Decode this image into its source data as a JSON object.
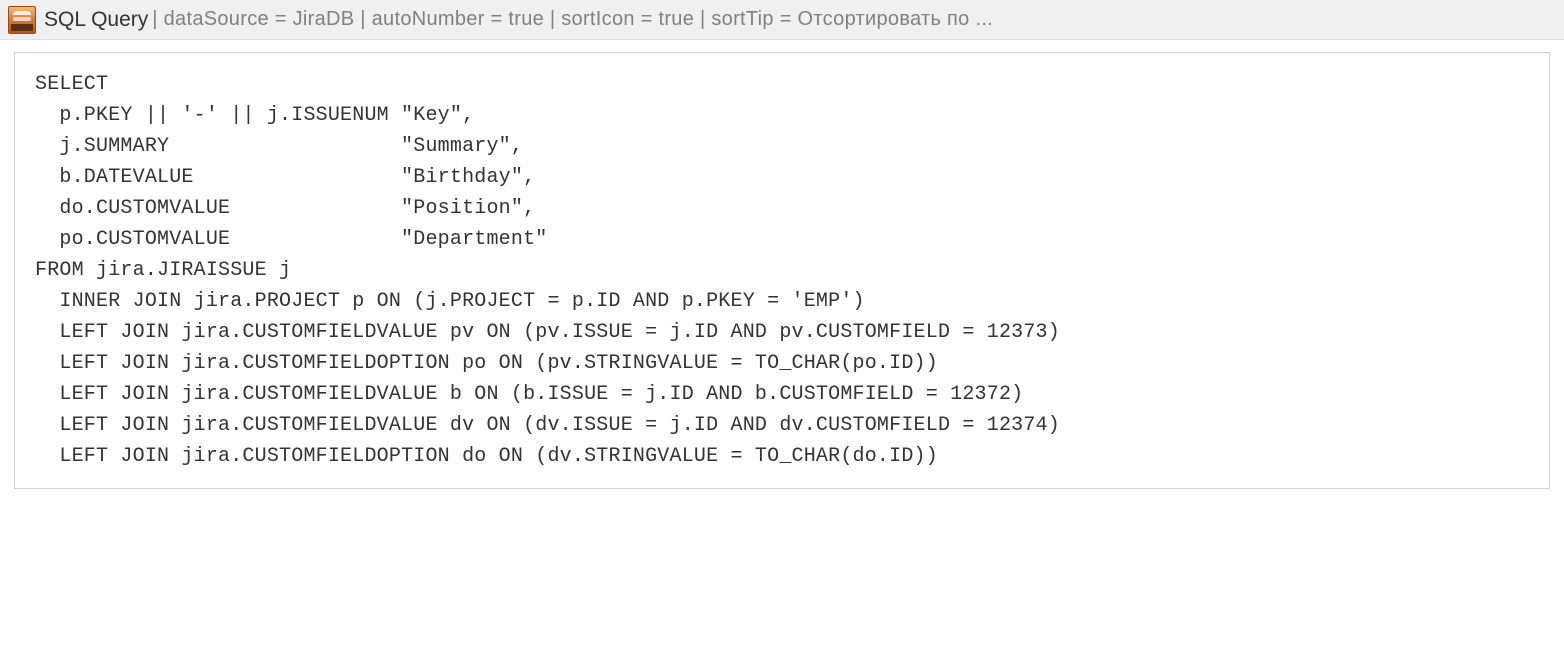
{
  "header": {
    "title": "SQL Query",
    "params": " | dataSource = JiraDB | autoNumber = true | sortIcon = true | sortTip = Отсортировать по ..."
  },
  "code": {
    "content": "SELECT\n  p.PKEY || '-' || j.ISSUENUM \"Key\",\n  j.SUMMARY                   \"Summary\",\n  b.DATEVALUE                 \"Birthday\",\n  do.CUSTOMVALUE              \"Position\",\n  po.CUSTOMVALUE              \"Department\"\nFROM jira.JIRAISSUE j\n  INNER JOIN jira.PROJECT p ON (j.PROJECT = p.ID AND p.PKEY = 'EMP')\n  LEFT JOIN jira.CUSTOMFIELDVALUE pv ON (pv.ISSUE = j.ID AND pv.CUSTOMFIELD = 12373)\n  LEFT JOIN jira.CUSTOMFIELDOPTION po ON (pv.STRINGVALUE = TO_CHAR(po.ID))\n  LEFT JOIN jira.CUSTOMFIELDVALUE b ON (b.ISSUE = j.ID AND b.CUSTOMFIELD = 12372)\n  LEFT JOIN jira.CUSTOMFIELDVALUE dv ON (dv.ISSUE = j.ID AND dv.CUSTOMFIELD = 12374)\n  LEFT JOIN jira.CUSTOMFIELDOPTION do ON (dv.STRINGVALUE = TO_CHAR(do.ID))"
  }
}
